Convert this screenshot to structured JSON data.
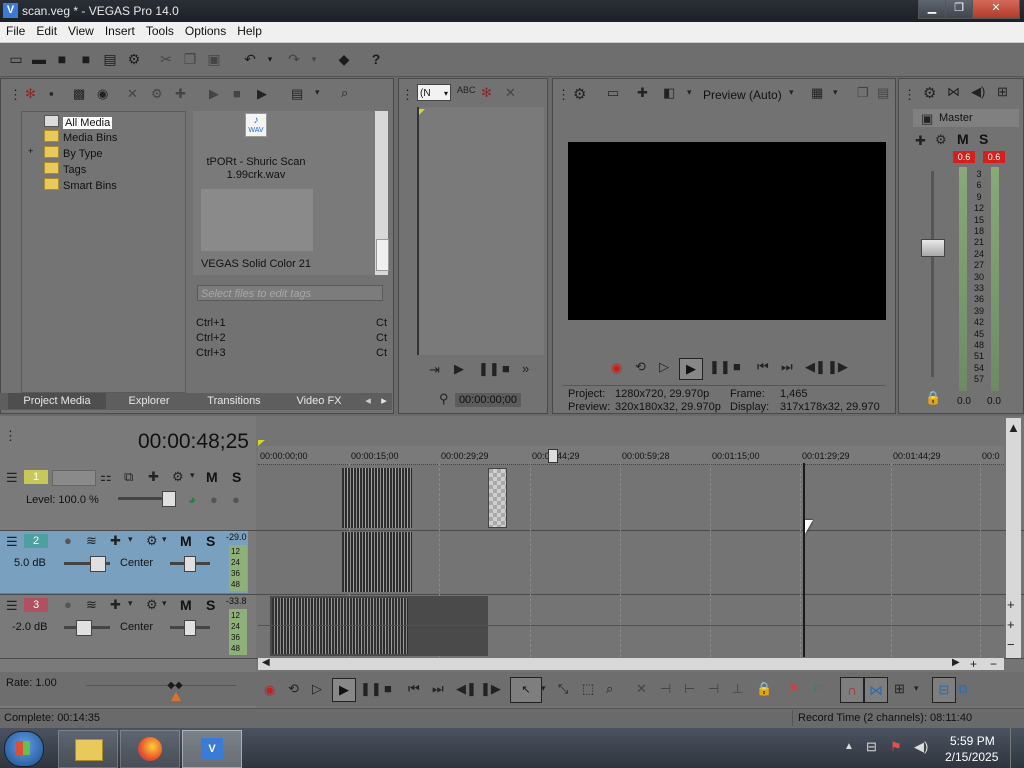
{
  "window": {
    "title": "scan.veg * - VEGAS Pro 14.0",
    "min": "▁",
    "max": "❐",
    "close": "✕"
  },
  "menu": [
    "File",
    "Edit",
    "View",
    "Insert",
    "Tools",
    "Options",
    "Help"
  ],
  "toolbar_icons": [
    "new-icon",
    "open-icon",
    "save-icon",
    "save-as-icon",
    "properties-icon",
    "cut-icon",
    "copy-icon",
    "paste-icon",
    "undo-icon",
    "redo-icon",
    "render-icon",
    "help-icon"
  ],
  "media": {
    "tree": [
      "All Media",
      "Media Bins",
      "By Type",
      "Tags",
      "Smart Bins"
    ],
    "expand_glyph": "+",
    "file1_badge": "WAV",
    "file1_name": "tPORt - Shuric Scan",
    "file1_name2": "1.99crk.wav",
    "file2_name": "VEGAS Solid Color 21",
    "tags_placeholder": "Select files to edit tags",
    "shortcuts": [
      "Ctrl+1",
      "Ctrl+2",
      "Ctrl+3"
    ],
    "shortcut_right": "Ct",
    "tabs": [
      "Project Media",
      "Explorer",
      "Transitions",
      "Video FX"
    ]
  },
  "trimmer": {
    "combo": "(N",
    "time": "00:00:00;00"
  },
  "preview": {
    "mode": "Preview (Auto)",
    "project_label": "Project:",
    "project_value": "1280x720, 29.970p",
    "preview_label": "Preview:",
    "preview_value": "320x180x32, 29.970p",
    "frame_label": "Frame:",
    "frame_value": "1,465",
    "display_label": "Display:",
    "display_value": "317x178x32, 29.970"
  },
  "master": {
    "title": "Master",
    "m": "M",
    "s": "S",
    "peak_left": "0.6",
    "peak_right": "0.6",
    "scale": [
      "3",
      "6",
      "9",
      "12",
      "15",
      "18",
      "21",
      "24",
      "27",
      "30",
      "33",
      "36",
      "39",
      "42",
      "45",
      "48",
      "51",
      "54",
      "57"
    ],
    "bottom_left": "0.0",
    "bottom_right": "0.0"
  },
  "timeline": {
    "cursor_time": "00:00:48;25",
    "ruler": [
      "00:00:00;00",
      "00:00:15;00",
      "00:00:29;29",
      "00:00:44;29",
      "00:00:59;28",
      "00:01:15;00",
      "00:01:29;29",
      "00:01:44;29",
      "00:0"
    ],
    "tracks": [
      {
        "num": "1",
        "label_key": "Level:",
        "label_val": "100.0 %",
        "m": "M",
        "s": "S",
        "color": "#c8c85a"
      },
      {
        "num": "2",
        "label_val": "5.0 dB",
        "pan": "Center",
        "m": "M",
        "s": "S",
        "meter": "-29.0",
        "color": "#4ea0a0"
      },
      {
        "num": "3",
        "label_val": "-2.0 dB",
        "pan": "Center",
        "m": "M",
        "s": "S",
        "meter": "-33.8",
        "color": "#b05060"
      }
    ],
    "meter_scale": [
      "12",
      "24",
      "36",
      "48"
    ],
    "rate": "Rate: 1.00"
  },
  "status": {
    "left": "Complete: 00:14:35",
    "right": "Record Time (2 channels): 08:11:40"
  },
  "taskbar": {
    "time": "5:59 PM",
    "date": "2/15/2025"
  }
}
